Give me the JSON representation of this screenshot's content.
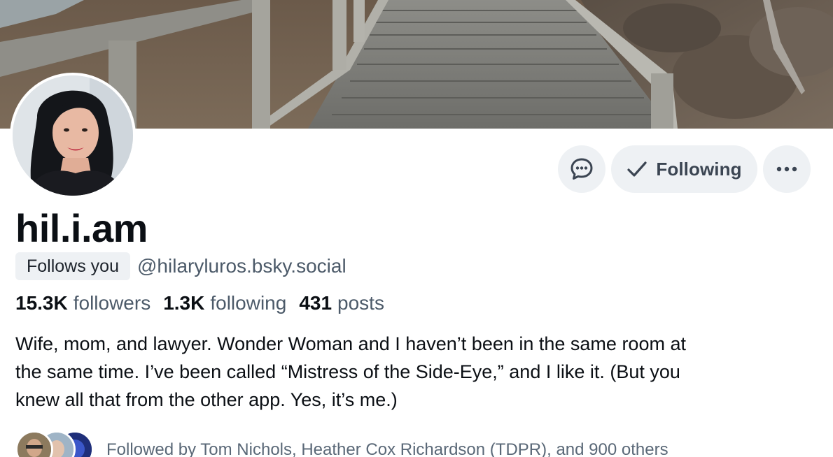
{
  "profile": {
    "display_name": "hil.i.am",
    "follows_you_badge": "Follows you",
    "handle": "@hilaryluros.bsky.social",
    "stats": {
      "followers_count": "15.3K",
      "followers_label": "followers",
      "following_count": "1.3K",
      "following_label": "following",
      "posts_count": "431",
      "posts_label": "posts"
    },
    "bio": "Wife, mom, and lawyer. Wonder Woman and I haven’t been in the same room at\nthe same time. I’ve been called “Mistress of the Side-Eye,” and I like it. (But you\nknew all that from the other app.  Yes, it’s me.)",
    "followed_by": "Followed by Tom Nichols, Heather Cox Richardson (TDPR), and 900 others"
  },
  "actions": {
    "message_icon": "chat-bubble-icon",
    "following_label": "Following",
    "following_icon": "checkmark-icon",
    "more_icon": "ellipsis-icon"
  },
  "colors": {
    "button_bg": "#eef1f4",
    "text_primary": "#0b0f14",
    "text_secondary": "#4c5a69"
  }
}
